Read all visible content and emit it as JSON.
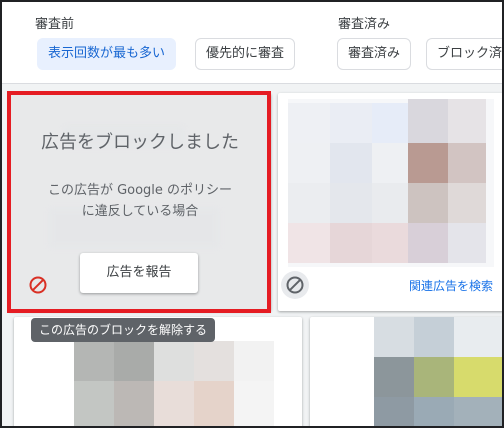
{
  "header": {
    "pending_label": "審査前",
    "reviewed_label": "審査済み",
    "chips": {
      "most_shown": "表示回数が最も多い",
      "priority_review": "優先的に審査",
      "reviewed": "審査済み",
      "blocked": "ブロック済"
    }
  },
  "blocked_card": {
    "title": "広告をブロックしました",
    "desc_line1": "この広告が Google のポリシー",
    "desc_line2": "に違反している場合",
    "report_button": "広告を報告",
    "unblock_icon": "block-icon"
  },
  "tooltip": "この広告のブロックを解除する",
  "ad_card": {
    "block_icon": "block-icon",
    "related_link": "関連広告を検索"
  },
  "colors": {
    "highlight_border": "#e51c23",
    "unblock_icon": "#d93025",
    "link": "#1a73e8",
    "chip_selected_bg": "#e8f0fe",
    "chip_selected_text": "#1967d2"
  }
}
